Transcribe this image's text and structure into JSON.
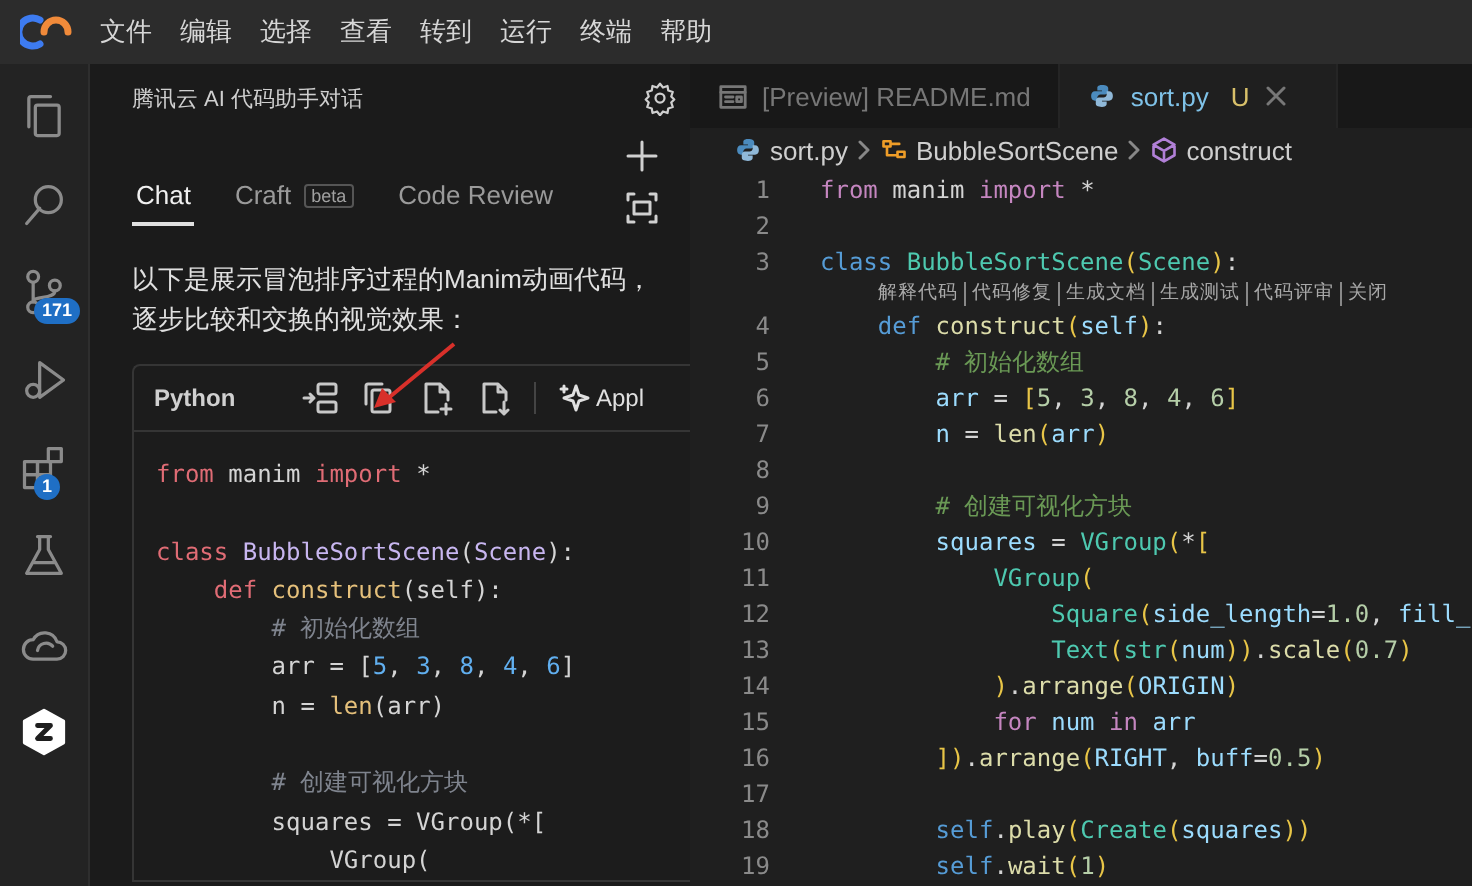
{
  "menu_bar": {
    "items": [
      "文件",
      "编辑",
      "选择",
      "查看",
      "转到",
      "运行",
      "终端",
      "帮助"
    ]
  },
  "activity_bar": [
    {
      "kind": "files"
    },
    {
      "kind": "search"
    },
    {
      "kind": "source-control",
      "badge": "171"
    },
    {
      "kind": "run"
    },
    {
      "kind": "extensions",
      "badge": "1"
    },
    {
      "kind": "flask"
    },
    {
      "kind": "cloud"
    },
    {
      "kind": "logo"
    }
  ],
  "chat": {
    "title": "腾讯云 AI 代码助手对话",
    "tabs": [
      {
        "label": "Chat",
        "selected": true
      },
      {
        "label": "Craft",
        "badge": "beta",
        "selected": false
      },
      {
        "label": "Code Review",
        "selected": false
      }
    ],
    "message_lines": [
      "以下是展示冒泡排序过程的Manim动画代码，",
      "逐步比较和交换的视觉效果："
    ],
    "code_block": {
      "language": "Python",
      "apply_label": "Appl",
      "lines": [
        {
          "kind": "code",
          "tokens": [
            {
              "kind": "kw",
              "text": "from"
            },
            {
              "kind": "pl",
              "text": " manim "
            },
            {
              "kind": "kw",
              "text": "import"
            },
            {
              "kind": "pl",
              "text": " *"
            }
          ]
        },
        {
          "kind": "blank"
        },
        {
          "kind": "code",
          "tokens": [
            {
              "kind": "st",
              "text": "class"
            },
            {
              "kind": "cls",
              "text": " BubbleSortScene"
            },
            {
              "kind": "pl",
              "text": "("
            },
            {
              "kind": "cls",
              "text": "Scene"
            },
            {
              "kind": "pl",
              "text": "):"
            }
          ]
        },
        {
          "kind": "code",
          "tokens": [
            {
              "kind": "st",
              "text": "    def"
            },
            {
              "kind": "fn",
              "text": " construct"
            },
            {
              "kind": "pl",
              "text": "(self):"
            }
          ]
        },
        {
          "kind": "code",
          "tokens": [
            {
              "kind": "cm",
              "text": "        # 初始化数组"
            }
          ]
        },
        {
          "kind": "code",
          "tokens": [
            {
              "kind": "pl",
              "text": "        arr = ["
            },
            {
              "kind": "num",
              "text": "5"
            },
            {
              "kind": "pl",
              "text": ", "
            },
            {
              "kind": "num",
              "text": "3"
            },
            {
              "kind": "pl",
              "text": ", "
            },
            {
              "kind": "num",
              "text": "8"
            },
            {
              "kind": "pl",
              "text": ", "
            },
            {
              "kind": "num",
              "text": "4"
            },
            {
              "kind": "pl",
              "text": ", "
            },
            {
              "kind": "num",
              "text": "6"
            },
            {
              "kind": "pl",
              "text": "]"
            }
          ]
        },
        {
          "kind": "code",
          "tokens": [
            {
              "kind": "pl",
              "text": "        n = "
            },
            {
              "kind": "fn",
              "text": "len"
            },
            {
              "kind": "pl",
              "text": "(arr)"
            }
          ]
        },
        {
          "kind": "blank"
        },
        {
          "kind": "code",
          "tokens": [
            {
              "kind": "cm",
              "text": "        # 创建可视化方块"
            }
          ]
        },
        {
          "kind": "code",
          "tokens": [
            {
              "kind": "pl",
              "text": "        squares = VGroup(*["
            }
          ]
        },
        {
          "kind": "code",
          "tokens": [
            {
              "kind": "pl",
              "text": "            VGroup("
            }
          ]
        }
      ]
    }
  },
  "editor": {
    "tabs": [
      {
        "kind": "preview",
        "label": "[Preview] README.md",
        "selected": false
      },
      {
        "kind": "python",
        "label": "sort.py",
        "status": "U",
        "selected": true
      }
    ],
    "breadcrumb": [
      {
        "kind": "python",
        "label": "sort.py"
      },
      {
        "kind": "class",
        "label": "BubbleSortScene"
      },
      {
        "kind": "method",
        "label": "construct"
      }
    ],
    "lines": [
      {
        "kind": "code",
        "number": "1",
        "tokens": [
          {
            "kind": "kw",
            "text": "from"
          },
          {
            "kind": "pl",
            "text": " manim "
          },
          {
            "kind": "kw",
            "text": "import"
          },
          {
            "kind": "pl",
            "text": " *"
          }
        ]
      },
      {
        "kind": "blank",
        "number": "2"
      },
      {
        "kind": "code",
        "number": "3",
        "tokens": [
          {
            "kind": "st",
            "text": "class"
          },
          {
            "kind": "cls",
            "text": " BubbleSortScene"
          },
          {
            "kind": "br",
            "text": "("
          },
          {
            "kind": "cls",
            "text": "Scene"
          },
          {
            "kind": "br",
            "text": ")"
          },
          {
            "kind": "pl",
            "text": ":"
          }
        ]
      },
      {
        "kind": "lens",
        "items": [
          "解释代码",
          "代码修复",
          "生成文档",
          "生成测试",
          "代码评审",
          "关闭"
        ]
      },
      {
        "kind": "code",
        "number": "4",
        "tokens": [
          {
            "kind": "st",
            "text": "    def"
          },
          {
            "kind": "fn",
            "text": " construct"
          },
          {
            "kind": "br",
            "text": "("
          },
          {
            "kind": "var",
            "text": "self"
          },
          {
            "kind": "br",
            "text": ")"
          },
          {
            "kind": "pl",
            "text": ":"
          }
        ]
      },
      {
        "kind": "code",
        "number": "5",
        "tokens": [
          {
            "kind": "cm",
            "text": "        # 初始化数组"
          }
        ]
      },
      {
        "kind": "code",
        "number": "6",
        "tokens": [
          {
            "kind": "var",
            "text": "        arr"
          },
          {
            "kind": "pl",
            "text": " = "
          },
          {
            "kind": "br",
            "text": "["
          },
          {
            "kind": "num",
            "text": "5"
          },
          {
            "kind": "pl",
            "text": ", "
          },
          {
            "kind": "num",
            "text": "3"
          },
          {
            "kind": "pl",
            "text": ", "
          },
          {
            "kind": "num",
            "text": "8"
          },
          {
            "kind": "pl",
            "text": ", "
          },
          {
            "kind": "num",
            "text": "4"
          },
          {
            "kind": "pl",
            "text": ", "
          },
          {
            "kind": "num",
            "text": "6"
          },
          {
            "kind": "br",
            "text": "]"
          }
        ]
      },
      {
        "kind": "code",
        "number": "7",
        "tokens": [
          {
            "kind": "var",
            "text": "        n"
          },
          {
            "kind": "pl",
            "text": " = "
          },
          {
            "kind": "fn",
            "text": "len"
          },
          {
            "kind": "br",
            "text": "("
          },
          {
            "kind": "var",
            "text": "arr"
          },
          {
            "kind": "br",
            "text": ")"
          }
        ]
      },
      {
        "kind": "blank",
        "number": "8"
      },
      {
        "kind": "code",
        "number": "9",
        "tokens": [
          {
            "kind": "cm",
            "text": "        # 创建可视化方块"
          }
        ]
      },
      {
        "kind": "code",
        "number": "10",
        "tokens": [
          {
            "kind": "var",
            "text": "        squares"
          },
          {
            "kind": "pl",
            "text": " = "
          },
          {
            "kind": "cls",
            "text": "VGroup"
          },
          {
            "kind": "br",
            "text": "("
          },
          {
            "kind": "pl",
            "text": "*"
          },
          {
            "kind": "br",
            "text": "["
          }
        ]
      },
      {
        "kind": "code",
        "number": "11",
        "tokens": [
          {
            "kind": "cls",
            "text": "            VGroup"
          },
          {
            "kind": "br",
            "text": "("
          }
        ]
      },
      {
        "kind": "code",
        "number": "12",
        "tokens": [
          {
            "kind": "cls",
            "text": "                Square"
          },
          {
            "kind": "br",
            "text": "("
          },
          {
            "kind": "var",
            "text": "side_length"
          },
          {
            "kind": "pl",
            "text": "="
          },
          {
            "kind": "num",
            "text": "1.0"
          },
          {
            "kind": "pl",
            "text": ", "
          },
          {
            "kind": "var",
            "text": "fill_"
          }
        ]
      },
      {
        "kind": "code",
        "number": "13",
        "tokens": [
          {
            "kind": "cls",
            "text": "                Text"
          },
          {
            "kind": "br",
            "text": "("
          },
          {
            "kind": "cls",
            "text": "str"
          },
          {
            "kind": "br",
            "text": "("
          },
          {
            "kind": "var",
            "text": "num"
          },
          {
            "kind": "br",
            "text": "))"
          },
          {
            "kind": "pl",
            "text": "."
          },
          {
            "kind": "fn",
            "text": "scale"
          },
          {
            "kind": "br",
            "text": "("
          },
          {
            "kind": "num",
            "text": "0.7"
          },
          {
            "kind": "br",
            "text": ")"
          }
        ]
      },
      {
        "kind": "code",
        "number": "14",
        "tokens": [
          {
            "kind": "br",
            "text": "            )"
          },
          {
            "kind": "pl",
            "text": "."
          },
          {
            "kind": "fn",
            "text": "arrange"
          },
          {
            "kind": "br",
            "text": "("
          },
          {
            "kind": "var",
            "text": "ORIGIN"
          },
          {
            "kind": "br",
            "text": ")"
          }
        ]
      },
      {
        "kind": "code",
        "number": "15",
        "tokens": [
          {
            "kind": "kw",
            "text": "            for"
          },
          {
            "kind": "var",
            "text": " num"
          },
          {
            "kind": "kw",
            "text": " in"
          },
          {
            "kind": "var",
            "text": " arr"
          }
        ]
      },
      {
        "kind": "code",
        "number": "16",
        "tokens": [
          {
            "kind": "br",
            "text": "        ])"
          },
          {
            "kind": "pl",
            "text": "."
          },
          {
            "kind": "fn",
            "text": "arrange"
          },
          {
            "kind": "br",
            "text": "("
          },
          {
            "kind": "var",
            "text": "RIGHT"
          },
          {
            "kind": "pl",
            "text": ", "
          },
          {
            "kind": "var",
            "text": "buff"
          },
          {
            "kind": "pl",
            "text": "="
          },
          {
            "kind": "num",
            "text": "0.5"
          },
          {
            "kind": "br",
            "text": ")"
          }
        ]
      },
      {
        "kind": "blank",
        "number": "17"
      },
      {
        "kind": "code",
        "number": "18",
        "tokens": [
          {
            "kind": "self",
            "text": "        self"
          },
          {
            "kind": "pl",
            "text": "."
          },
          {
            "kind": "fn",
            "text": "play"
          },
          {
            "kind": "br",
            "text": "("
          },
          {
            "kind": "cls",
            "text": "Create"
          },
          {
            "kind": "br",
            "text": "("
          },
          {
            "kind": "var",
            "text": "squares"
          },
          {
            "kind": "br",
            "text": "))"
          }
        ]
      },
      {
        "kind": "code",
        "number": "19",
        "tokens": [
          {
            "kind": "self",
            "text": "        self"
          },
          {
            "kind": "pl",
            "text": "."
          },
          {
            "kind": "fn",
            "text": "wait"
          },
          {
            "kind": "br",
            "text": "("
          },
          {
            "kind": "num",
            "text": "1"
          },
          {
            "kind": "br",
            "text": ")"
          }
        ]
      }
    ]
  }
}
